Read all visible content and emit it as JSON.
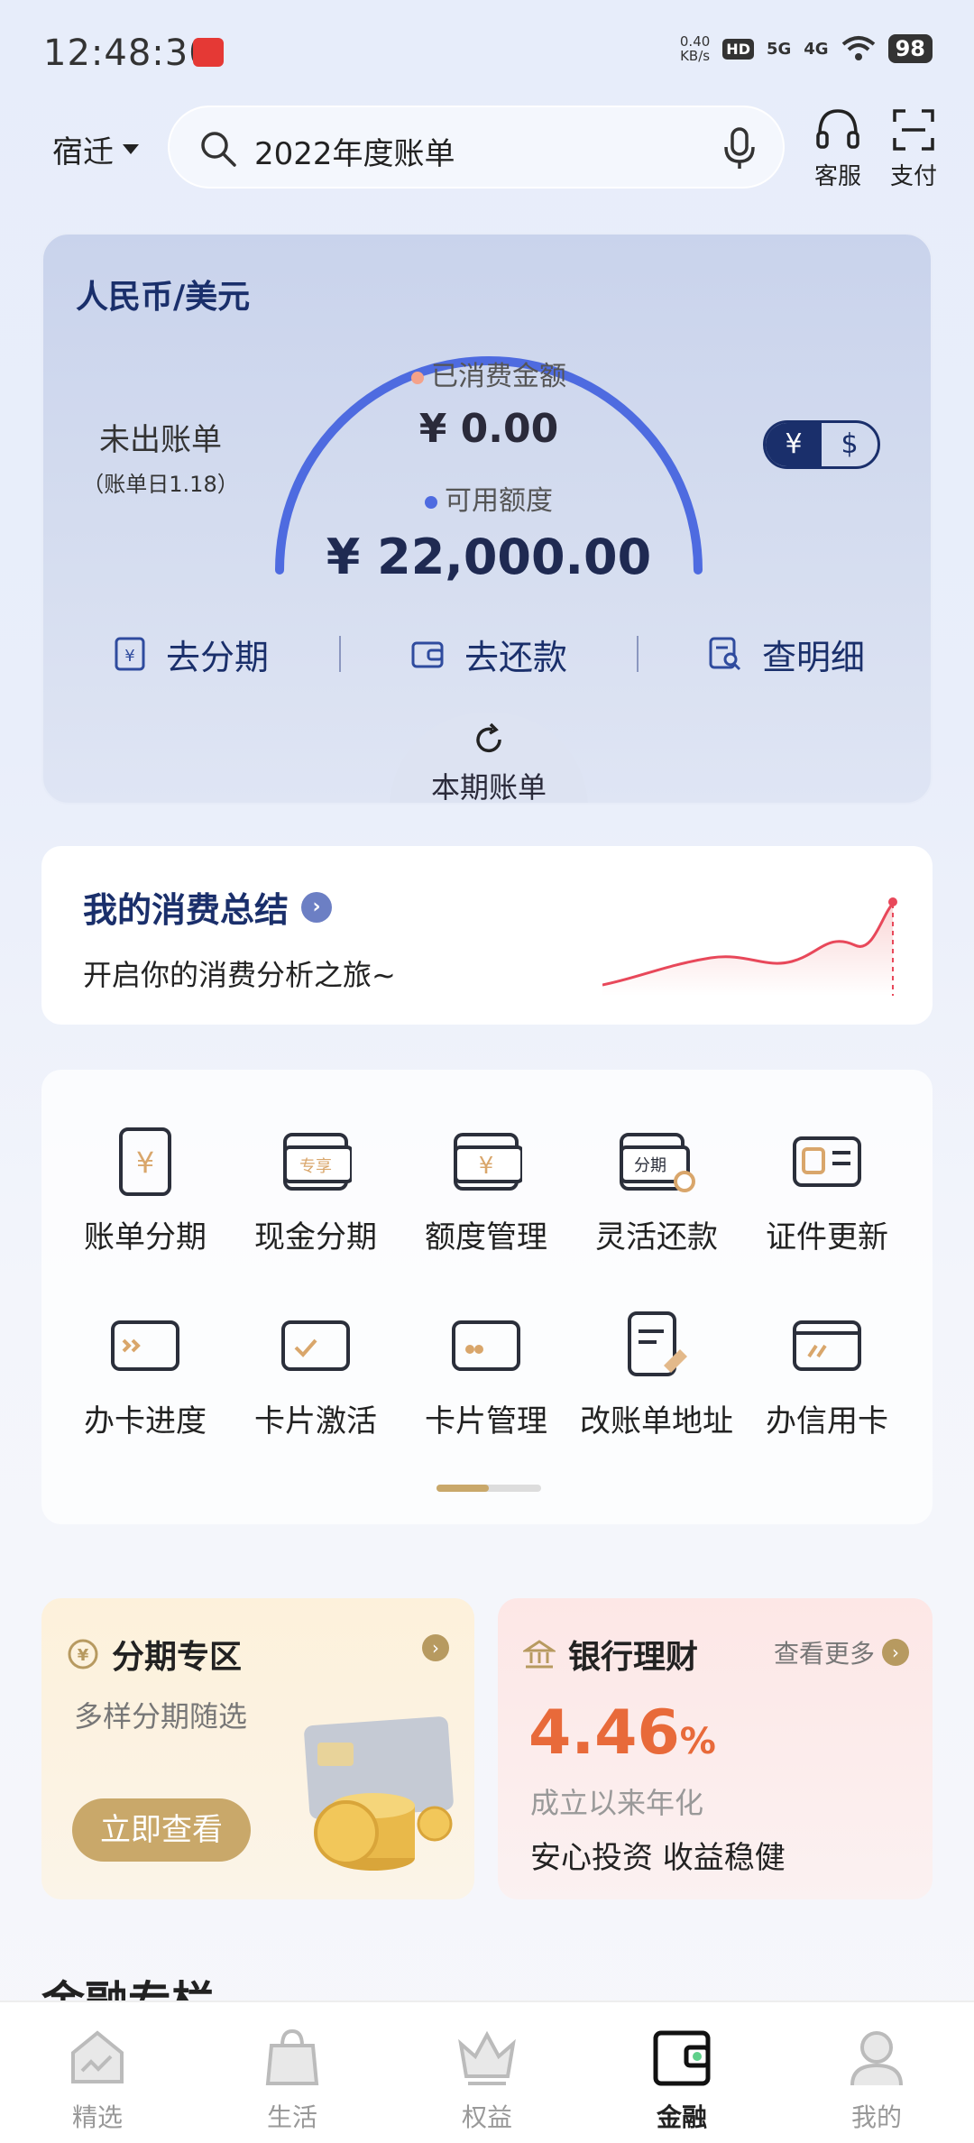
{
  "status_bar": {
    "time": "12:48:30",
    "net_speed": "0.40",
    "net_unit": "KB/s",
    "hd": "HD",
    "sig1": "5G",
    "sig2": "4G",
    "battery": "98"
  },
  "header": {
    "city": "宿迁",
    "search_text": "2022年度账单",
    "service_label": "客服",
    "pay_label": "支付"
  },
  "bill_card": {
    "currency_label": "人民币/美元",
    "unbilled": "未出账单",
    "bill_day": "（账单日1.18）",
    "consumed_label": "已消费金额",
    "consumed_value": "¥ 0.00",
    "available_label": "可用额度",
    "available_value": "¥ 22,000.00",
    "toggle_cny": "¥",
    "toggle_usd": "$",
    "actions": [
      {
        "label": "去分期",
        "icon": "installment-icon"
      },
      {
        "label": "去还款",
        "icon": "wallet-icon"
      },
      {
        "label": "查明细",
        "icon": "details-icon"
      }
    ],
    "tab_label": "本期账单",
    "colors": {
      "gauge": "#4e6be0",
      "consumed_dot": "#f4a28a",
      "available_dot": "#4e6be0"
    }
  },
  "summary": {
    "title": "我的消费总结",
    "subtitle": "开启你的消费分析之旅~"
  },
  "services": [
    {
      "label": "账单分期",
      "icon": "bill-installment-icon"
    },
    {
      "label": "现金分期",
      "icon": "cash-installment-icon"
    },
    {
      "label": "额度管理",
      "icon": "limit-management-icon"
    },
    {
      "label": "灵活还款",
      "icon": "flexible-repay-icon"
    },
    {
      "label": "证件更新",
      "icon": "id-update-icon"
    },
    {
      "label": "办卡进度",
      "icon": "card-progress-icon"
    },
    {
      "label": "卡片激活",
      "icon": "card-activate-icon"
    },
    {
      "label": "卡片管理",
      "icon": "card-management-icon"
    },
    {
      "label": "改账单地址",
      "icon": "address-edit-icon"
    },
    {
      "label": "办信用卡",
      "icon": "apply-card-icon"
    }
  ],
  "service_icon_text": {
    "cash_tag": "专享",
    "flex_tag": "分期"
  },
  "promo_installment": {
    "title": "分期专区",
    "subtitle": "多样分期随选",
    "button": "立即查看"
  },
  "promo_wealth": {
    "title": "银行理财",
    "more": "查看更多",
    "rate": "4.46",
    "rate_unit": "%",
    "rate_label": "成立以来年化",
    "tagline": "安心投资 收益稳健"
  },
  "section_title": "金融专栏",
  "bottom_nav": [
    {
      "label": "精选",
      "icon": "home-icon",
      "active": false
    },
    {
      "label": "生活",
      "icon": "bag-icon",
      "active": false
    },
    {
      "label": "权益",
      "icon": "crown-icon",
      "active": false
    },
    {
      "label": "金融",
      "icon": "wallet-icon",
      "active": true
    },
    {
      "label": "我的",
      "icon": "profile-icon",
      "active": false
    }
  ]
}
